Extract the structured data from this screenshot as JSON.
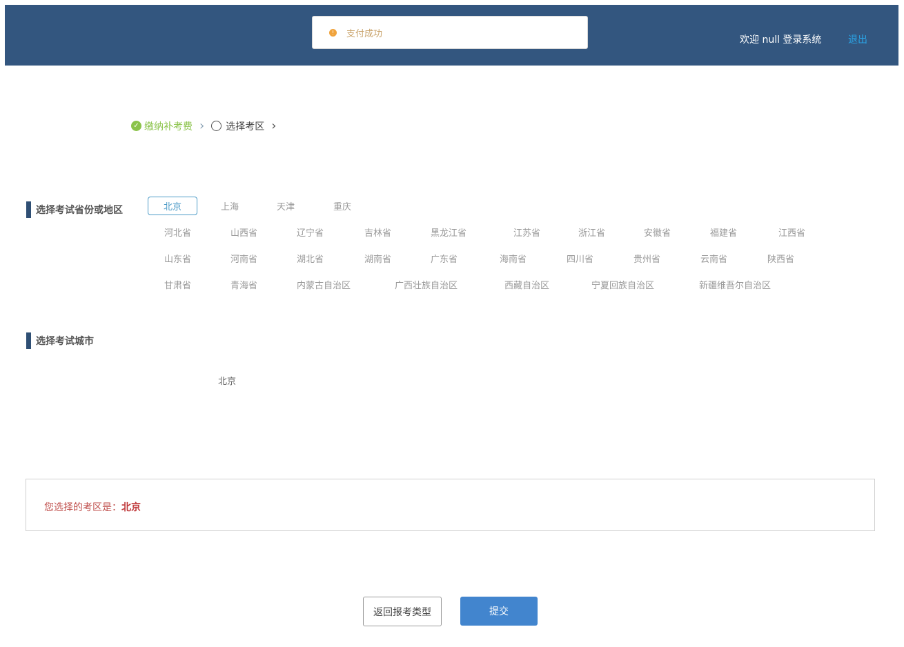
{
  "header": {
    "toast_text": "支付成功",
    "welcome": "欢迎 null 登录系统",
    "logout": "退出"
  },
  "steps": [
    {
      "label": "缴纳补考费",
      "status": "done"
    },
    {
      "label": "选择考区",
      "status": "current"
    }
  ],
  "province_section": {
    "title": "选择考试省份或地区",
    "selected": "北京",
    "rows": [
      [
        "北京",
        "上海",
        "天津",
        "重庆"
      ],
      [
        "河北省",
        "山西省",
        "辽宁省",
        "吉林省",
        "黑龙江省",
        "江苏省",
        "浙江省",
        "安徽省",
        "福建省",
        "江西省"
      ],
      [
        "山东省",
        "河南省",
        "湖北省",
        "湖南省",
        "广东省",
        "海南省",
        "四川省",
        "贵州省",
        "云南省",
        "陕西省"
      ],
      [
        "甘肃省",
        "青海省",
        "内蒙古自治区",
        "广西壮族自治区",
        "西藏自治区",
        "宁夏回族自治区",
        "新疆维吾尔自治区"
      ]
    ]
  },
  "city_section": {
    "title": "选择考试城市",
    "cities": [
      "北京"
    ]
  },
  "selection": {
    "prefix": "您选择的考区是：",
    "value": "北京"
  },
  "buttons": {
    "back": "返回报考类型",
    "submit": "提交"
  },
  "colors": {
    "header_bg": "#33567f",
    "accent_blue": "#4285ce",
    "done_green": "#8bc34a",
    "highlight_red": "#c0393b"
  }
}
